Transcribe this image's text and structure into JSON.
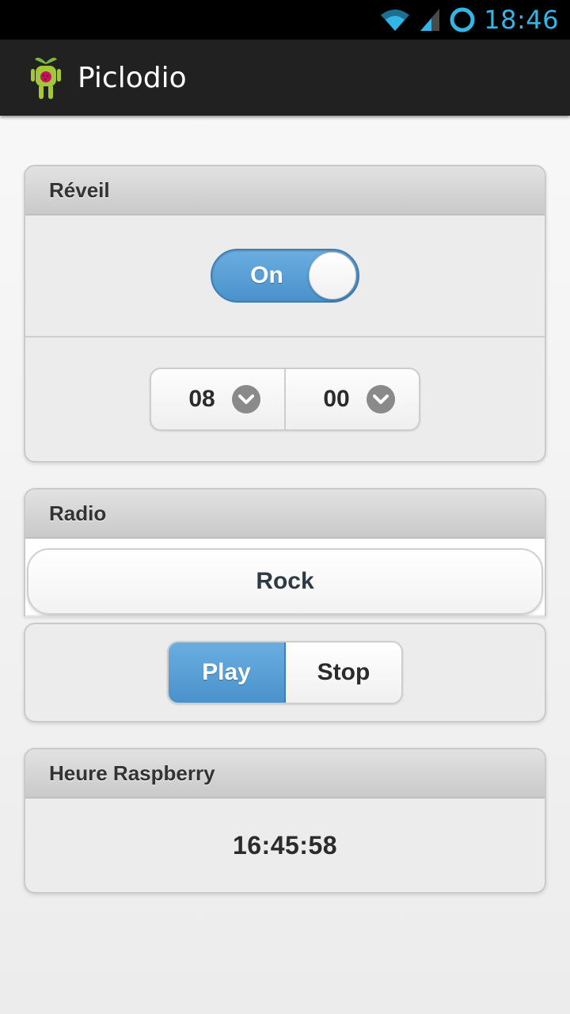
{
  "status_bar": {
    "time": "18:46",
    "icons": [
      "wifi-icon",
      "signal-icon",
      "sync-circle-icon"
    ]
  },
  "app": {
    "title": "Piclodio",
    "icon": "android-raspberry-logo"
  },
  "alarm_section": {
    "title": "Réveil",
    "toggle": {
      "label": "On",
      "state": "on"
    },
    "hour_select": {
      "value": "08",
      "icon": "chevron-down-icon"
    },
    "minute_select": {
      "value": "00",
      "icon": "chevron-down-icon"
    }
  },
  "radio_section": {
    "title": "Radio",
    "stations": [
      "Rock"
    ],
    "controls": {
      "play_label": "Play",
      "stop_label": "Stop",
      "active": "Play"
    }
  },
  "clock_section": {
    "title": "Heure Raspberry",
    "time": "16:45:58"
  },
  "colors": {
    "accent_blue": "#4a92cc",
    "status_time": "#33b5e5",
    "action_bar": "#212121"
  }
}
